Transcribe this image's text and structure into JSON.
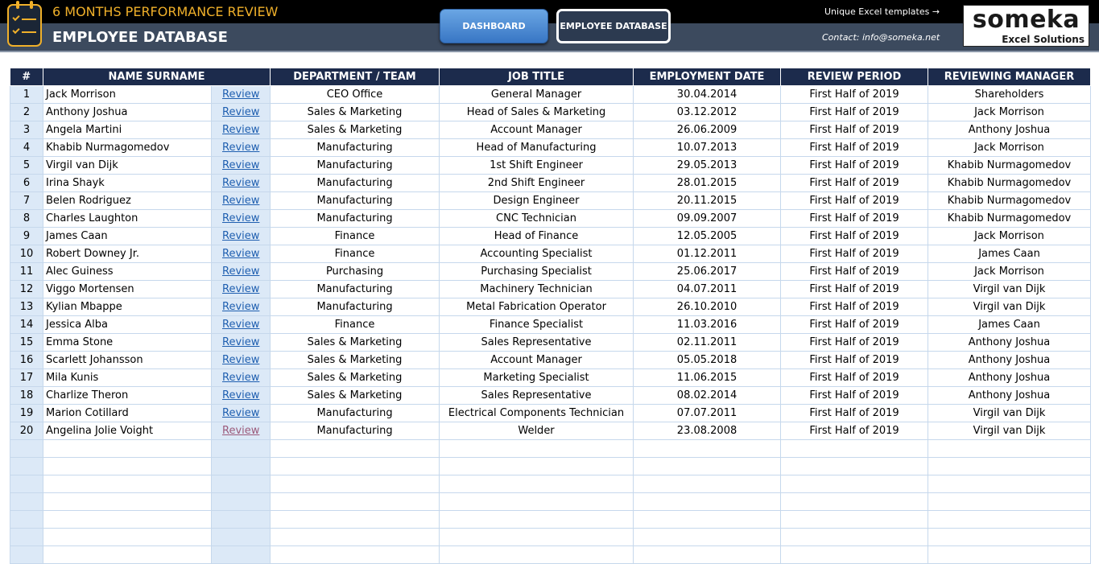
{
  "header": {
    "app_title": "6 MONTHS PERFORMANCE REVIEW",
    "page_title": "EMPLOYEE DATABASE",
    "nav": {
      "dashboard": "DASHBOARD",
      "employee_database": "EMPLOYEE DATABASE"
    },
    "templates_link": "Unique Excel templates →",
    "contact": "Contact: info@someka.net",
    "brand_name": "someka",
    "brand_sub": "Excel Solutions"
  },
  "colors": {
    "accent": "#f0b02a",
    "header_bg": "#1c2b4c",
    "link": "#1f5fb0",
    "link_visited": "#9c5a7a",
    "band": "#dce9f7"
  },
  "table": {
    "columns": [
      "#",
      "NAME SURNAME",
      "DEPARTMENT / TEAM",
      "JOB TITLE",
      "EMPLOYMENT DATE",
      "REVIEW PERIOD",
      "REVIEWING MANAGER"
    ],
    "review_label": "Review",
    "empty_rows": 7,
    "rows": [
      {
        "n": "1",
        "name": "Jack Morrison",
        "dept": "CEO Office",
        "title": "General Manager",
        "date": "30.04.2014",
        "period": "First Half of 2019",
        "manager": "Shareholders"
      },
      {
        "n": "2",
        "name": "Anthony Joshua",
        "dept": "Sales & Marketing",
        "title": "Head of Sales & Marketing",
        "date": "03.12.2012",
        "period": "First Half of 2019",
        "manager": "Jack Morrison"
      },
      {
        "n": "3",
        "name": "Angela Martini",
        "dept": "Sales & Marketing",
        "title": "Account Manager",
        "date": "26.06.2009",
        "period": "First Half of 2019",
        "manager": "Anthony Joshua"
      },
      {
        "n": "4",
        "name": "Khabib Nurmagomedov",
        "dept": "Manufacturing",
        "title": "Head of Manufacturing",
        "date": "10.07.2013",
        "period": "First Half of 2019",
        "manager": "Jack Morrison"
      },
      {
        "n": "5",
        "name": "Virgil van Dijk",
        "dept": "Manufacturing",
        "title": "1st Shift Engineer",
        "date": "29.05.2013",
        "period": "First Half of 2019",
        "manager": "Khabib Nurmagomedov"
      },
      {
        "n": "6",
        "name": "Irina Shayk",
        "dept": "Manufacturing",
        "title": "2nd Shift Engineer",
        "date": "28.01.2015",
        "period": "First Half of 2019",
        "manager": "Khabib Nurmagomedov"
      },
      {
        "n": "7",
        "name": "Belen Rodriguez",
        "dept": "Manufacturing",
        "title": "Design Engineer",
        "date": "20.11.2015",
        "period": "First Half of 2019",
        "manager": "Khabib Nurmagomedov"
      },
      {
        "n": "8",
        "name": "Charles Laughton",
        "dept": "Manufacturing",
        "title": "CNC Technician",
        "date": "09.09.2007",
        "period": "First Half of 2019",
        "manager": "Khabib Nurmagomedov"
      },
      {
        "n": "9",
        "name": "James Caan",
        "dept": "Finance",
        "title": "Head of Finance",
        "date": "12.05.2005",
        "period": "First Half of 2019",
        "manager": "Jack Morrison"
      },
      {
        "n": "10",
        "name": "Robert Downey Jr.",
        "dept": "Finance",
        "title": "Accounting Specialist",
        "date": "01.12.2011",
        "period": "First Half of 2019",
        "manager": "James Caan"
      },
      {
        "n": "11",
        "name": "Alec Guiness",
        "dept": "Purchasing",
        "title": "Purchasing Specialist",
        "date": "25.06.2017",
        "period": "First Half of 2019",
        "manager": "Jack Morrison"
      },
      {
        "n": "12",
        "name": "Viggo Mortensen",
        "dept": "Manufacturing",
        "title": "Machinery Technician",
        "date": "04.07.2011",
        "period": "First Half of 2019",
        "manager": "Virgil van Dijk"
      },
      {
        "n": "13",
        "name": "Kylian Mbappe",
        "dept": "Manufacturing",
        "title": "Metal Fabrication Operator",
        "date": "26.10.2010",
        "period": "First Half of 2019",
        "manager": "Virgil van Dijk"
      },
      {
        "n": "14",
        "name": "Jessica Alba",
        "dept": "Finance",
        "title": "Finance Specialist",
        "date": "11.03.2016",
        "period": "First Half of 2019",
        "manager": "James Caan"
      },
      {
        "n": "15",
        "name": "Emma Stone",
        "dept": "Sales & Marketing",
        "title": "Sales Representative",
        "date": "02.11.2011",
        "period": "First Half of 2019",
        "manager": "Anthony Joshua"
      },
      {
        "n": "16",
        "name": "Scarlett Johansson",
        "dept": "Sales & Marketing",
        "title": "Account Manager",
        "date": "05.05.2018",
        "period": "First Half of 2019",
        "manager": "Anthony Joshua"
      },
      {
        "n": "17",
        "name": "Mila Kunis",
        "dept": "Sales & Marketing",
        "title": "Marketing Specialist",
        "date": "11.06.2015",
        "period": "First Half of 2019",
        "manager": "Anthony Joshua"
      },
      {
        "n": "18",
        "name": "Charlize Theron",
        "dept": "Sales & Marketing",
        "title": "Sales Representative",
        "date": "08.02.2014",
        "period": "First Half of 2019",
        "manager": "Anthony Joshua"
      },
      {
        "n": "19",
        "name": "Marion Cotillard",
        "dept": "Manufacturing",
        "title": "Electrical Components Technician",
        "date": "07.07.2011",
        "period": "First Half of 2019",
        "manager": "Virgil van Dijk"
      },
      {
        "n": "20",
        "name": "Angelina Jolie Voight",
        "dept": "Manufacturing",
        "title": "Welder",
        "date": "23.08.2008",
        "period": "First Half of 2019",
        "manager": "Virgil van Dijk",
        "visited": true
      }
    ]
  }
}
